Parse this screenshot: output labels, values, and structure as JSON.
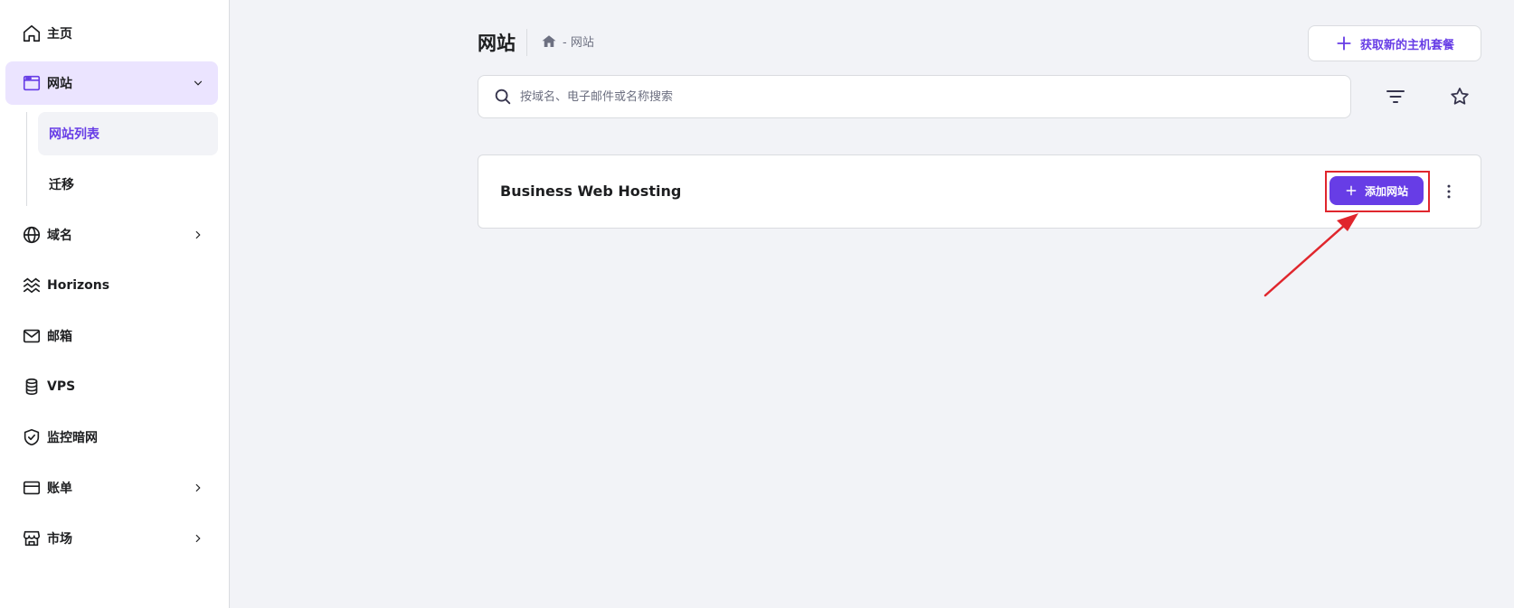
{
  "sidebar": {
    "items": [
      {
        "label": "主页",
        "icon": "home-icon"
      },
      {
        "label": "网站",
        "icon": "browser-window-icon",
        "expanded": true
      },
      {
        "label": "域名",
        "icon": "globe-icon"
      },
      {
        "label": "Horizons",
        "icon": "horizons-waves-icon"
      },
      {
        "label": "邮箱",
        "icon": "mail-icon"
      },
      {
        "label": "VPS",
        "icon": "database-icon"
      },
      {
        "label": "监控暗网",
        "icon": "shield-check-icon"
      },
      {
        "label": "账单",
        "icon": "credit-card-icon"
      },
      {
        "label": "市场",
        "icon": "storefront-icon"
      }
    ],
    "subitems": [
      {
        "label": "网站列表",
        "active": true
      },
      {
        "label": "迁移",
        "active": false
      }
    ]
  },
  "header": {
    "title": "网站",
    "breadcrumb": "- 网站",
    "get_hosting_label": "获取新的主机套餐"
  },
  "search": {
    "placeholder": "按域名、电子邮件或名称搜索",
    "value": ""
  },
  "hosting_card": {
    "title": "Business Web Hosting",
    "add_site_label": "添加网站"
  },
  "colors": {
    "accent": "#673de6",
    "annotation_red": "#e0262d",
    "background": "#f2f3f7"
  }
}
